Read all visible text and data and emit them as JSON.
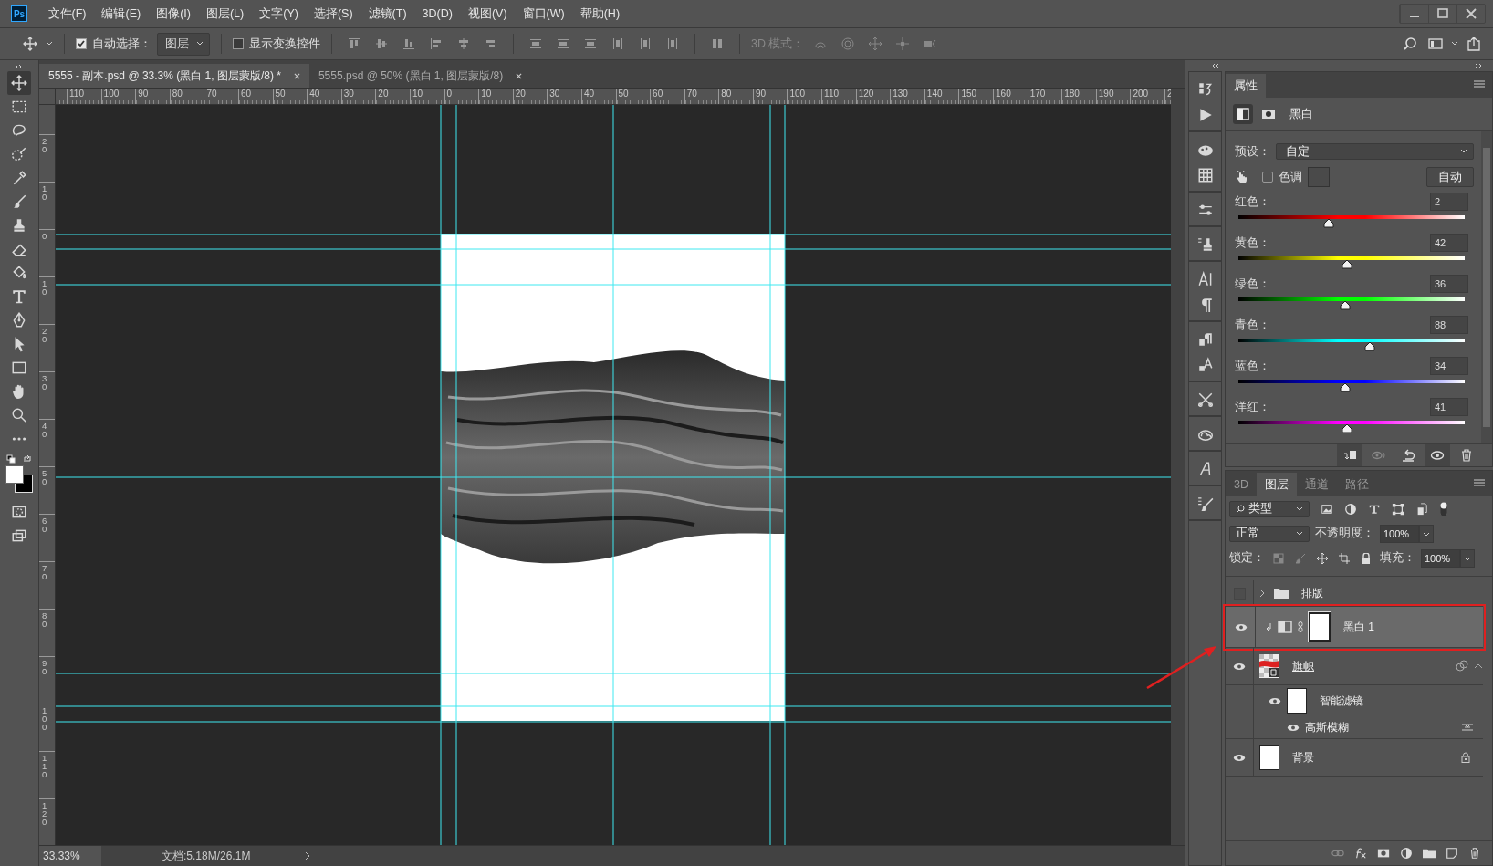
{
  "menu_bar": {
    "logo": "Ps",
    "items": [
      "文件(F)",
      "编辑(E)",
      "图像(I)",
      "图层(L)",
      "文字(Y)",
      "选择(S)",
      "滤镜(T)",
      "3D(D)",
      "视图(V)",
      "窗口(W)",
      "帮助(H)"
    ]
  },
  "options_bar": {
    "auto_select": {
      "label": "自动选择：",
      "checked": true
    },
    "auto_select_target": "图层",
    "transform_controls": {
      "label": "显示变换控件",
      "checked": false
    },
    "mode_3d": {
      "label": "3D 模式：",
      "disabled": true
    }
  },
  "document_tabs": [
    {
      "title": "5555 - 副本.psd @ 33.3% (黑白 1, 图层蒙版/8) *",
      "selected": true
    },
    {
      "title": "5555.psd @ 50% (黑白 1, 图层蒙版/8)",
      "selected": false
    }
  ],
  "rulers": {
    "horizontal": [
      "110",
      "100",
      "90",
      "80",
      "70",
      "60",
      "50",
      "40",
      "30",
      "20",
      "10",
      "0",
      "10",
      "20",
      "30",
      "40",
      "50",
      "60",
      "70",
      "80",
      "90",
      "100",
      "110",
      "120",
      "130",
      "140",
      "150",
      "160",
      "170",
      "180",
      "190",
      "200",
      "2"
    ],
    "vertical": [
      "20",
      "10",
      "0",
      "10",
      "20",
      "30",
      "40",
      "50",
      "60",
      "70",
      "80",
      "90",
      "100",
      "110",
      "120"
    ]
  },
  "status_bar": {
    "zoom": "33.33%",
    "doc_info": "文档:5.18M/26.1M"
  },
  "properties_panel": {
    "tab": "属性",
    "adjustment_name": "黑白",
    "preset_label": "预设：",
    "preset_value": "自定",
    "tint": {
      "label": "色调",
      "checked": false
    },
    "auto_button": "自动",
    "sliders": [
      {
        "label": "红色：",
        "value": "2",
        "level": 0.4,
        "color": "#ff0000"
      },
      {
        "label": "黄色：",
        "value": "42",
        "level": 0.48,
        "color": "#ffff00"
      },
      {
        "label": "绿色：",
        "value": "36",
        "level": 0.47,
        "color": "#00ff00"
      },
      {
        "label": "青色：",
        "value": "88",
        "level": 0.58,
        "color": "#00ffff"
      },
      {
        "label": "蓝色：",
        "value": "34",
        "level": 0.47,
        "color": "#0000ff"
      },
      {
        "label": "洋红：",
        "value": "41",
        "level": 0.48,
        "color": "#ff00ff"
      }
    ]
  },
  "layers_panel": {
    "tabs": [
      {
        "label": "3D",
        "selected": false
      },
      {
        "label": "图层",
        "selected": true
      },
      {
        "label": "通道",
        "selected": false
      },
      {
        "label": "路径",
        "selected": false
      }
    ],
    "filter": "类型",
    "blend_mode": "正常",
    "opacity_label": "不透明度：",
    "opacity": "100%",
    "lock_label": "锁定：",
    "fill_label": "填充：",
    "fill": "100%",
    "layers": [
      {
        "name": "排版",
        "kind": "group",
        "visible": false,
        "expanded": false,
        "selected": false,
        "highlighted": false
      },
      {
        "name": "黑白 1",
        "kind": "adjustment",
        "visible": true,
        "selected": true,
        "highlighted": true
      },
      {
        "name": "旗帜",
        "kind": "smart",
        "visible": true,
        "expanded": true,
        "selected": false,
        "highlighted": false,
        "children": [
          {
            "name": "智能滤镜",
            "kind": "smart_filters",
            "visible": true
          },
          {
            "name": "高斯模糊",
            "kind": "filter",
            "visible": true
          }
        ]
      },
      {
        "name": "背景",
        "kind": "background",
        "visible": true,
        "locked": true,
        "selected": false,
        "highlighted": false
      }
    ]
  }
}
